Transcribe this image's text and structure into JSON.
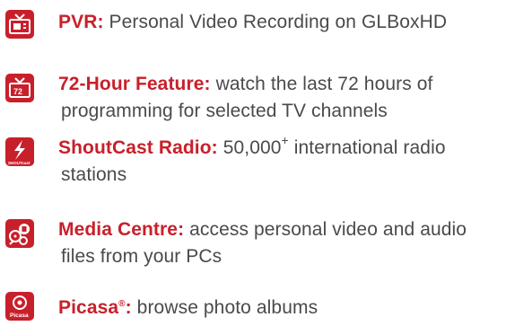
{
  "features": [
    {
      "icon": "tv-icon",
      "title": "PVR:",
      "description_line1": "Personal Video Recording on GLBoxHD",
      "description_line2": ""
    },
    {
      "icon": "tv-72-icon",
      "icon_label": "72",
      "title": "72-Hour Feature:",
      "description_line1": "watch the last 72 hours of",
      "description_line2": "programming for selected TV channels"
    },
    {
      "icon": "shoutcast-icon",
      "icon_label": "SHOUTcast",
      "title": "ShoutCast Radio:",
      "description_line1": "50,000",
      "description_sup": "+",
      "description_line1_rest": "international radio",
      "description_line2": "stations"
    },
    {
      "icon": "media-centre-icon",
      "title": "Media Centre:",
      "description_line1": "access personal video and audio",
      "description_line2": "files from your PCs"
    },
    {
      "icon": "picasa-icon",
      "icon_label": "Picasa",
      "title": "Picasa",
      "title_mark": "®",
      "title_colon": ":",
      "description_line1": "browse photo albums",
      "description_line2": ""
    }
  ],
  "colors": {
    "accent": "#c8202b",
    "text": "#4a4a4a",
    "background": "#ffffff"
  }
}
